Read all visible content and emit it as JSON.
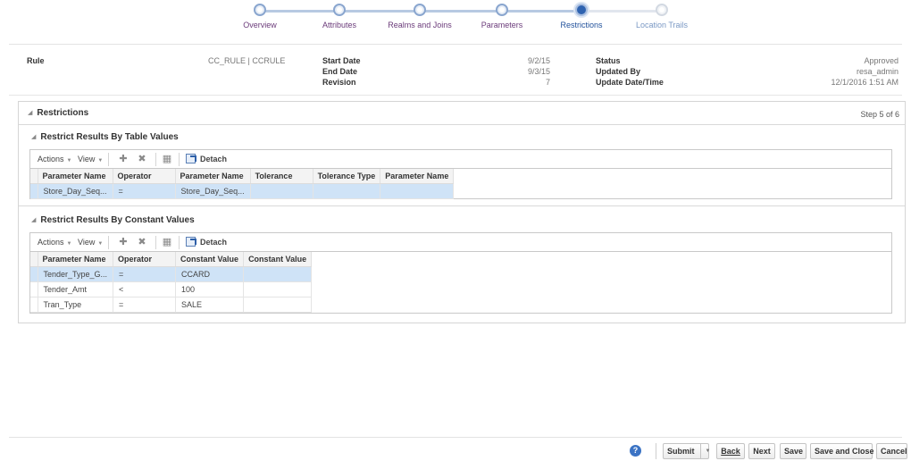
{
  "train": {
    "steps": [
      {
        "label": "Overview",
        "state": "visited"
      },
      {
        "label": "Attributes",
        "state": "visited"
      },
      {
        "label": "Realms and Joins",
        "state": "visited"
      },
      {
        "label": "Parameters",
        "state": "visited"
      },
      {
        "label": "Restrictions",
        "state": "current"
      },
      {
        "label": "Location Trails",
        "state": "future"
      }
    ]
  },
  "info": {
    "rule_label": "Rule",
    "rule_value": "CC_RULE | CCRULE",
    "start_date_label": "Start Date",
    "start_date_value": "9/2/15",
    "end_date_label": "End Date",
    "end_date_value": "9/3/15",
    "revision_label": "Revision",
    "revision_value": "7",
    "status_label": "Status",
    "status_value": "Approved",
    "updated_by_label": "Updated By",
    "updated_by_value": "resa_admin",
    "update_dt_label": "Update Date/Time",
    "update_dt_value": "12/1/2016 1:51 AM"
  },
  "restrictions": {
    "title": "Restrictions",
    "step_text": "Step 5 of 6",
    "table_values": {
      "title": "Restrict Results By Table Values",
      "toolbar": {
        "actions": "Actions",
        "view": "View",
        "detach": "Detach"
      },
      "columns": [
        "Parameter Name",
        "Operator",
        "Parameter Name",
        "Tolerance",
        "Tolerance Type",
        "Parameter Name"
      ],
      "rows": [
        [
          "Store_Day_Seq...",
          "=",
          "Store_Day_Seq...",
          "",
          "",
          ""
        ]
      ]
    },
    "constant_values": {
      "title": "Restrict Results By Constant Values",
      "toolbar": {
        "actions": "Actions",
        "view": "View",
        "detach": "Detach"
      },
      "columns": [
        "Parameter Name",
        "Operator",
        "Constant Value",
        "Constant Value"
      ],
      "rows": [
        [
          "Tender_Type_G...",
          "=",
          "CCARD",
          ""
        ],
        [
          "Tender_Amt",
          "<",
          "100",
          ""
        ],
        [
          "Tran_Type",
          "=",
          "SALE",
          ""
        ]
      ]
    }
  },
  "footer": {
    "help": "?",
    "submit": "Submit",
    "back": "Back",
    "next": "Next",
    "save": "Save",
    "save_close": "Save and Close",
    "cancel": "Cancel"
  },
  "colors": {
    "accent": "#2f63b0",
    "selected_row": "#cfe3f7",
    "visited_label": "#6b3b7a"
  }
}
